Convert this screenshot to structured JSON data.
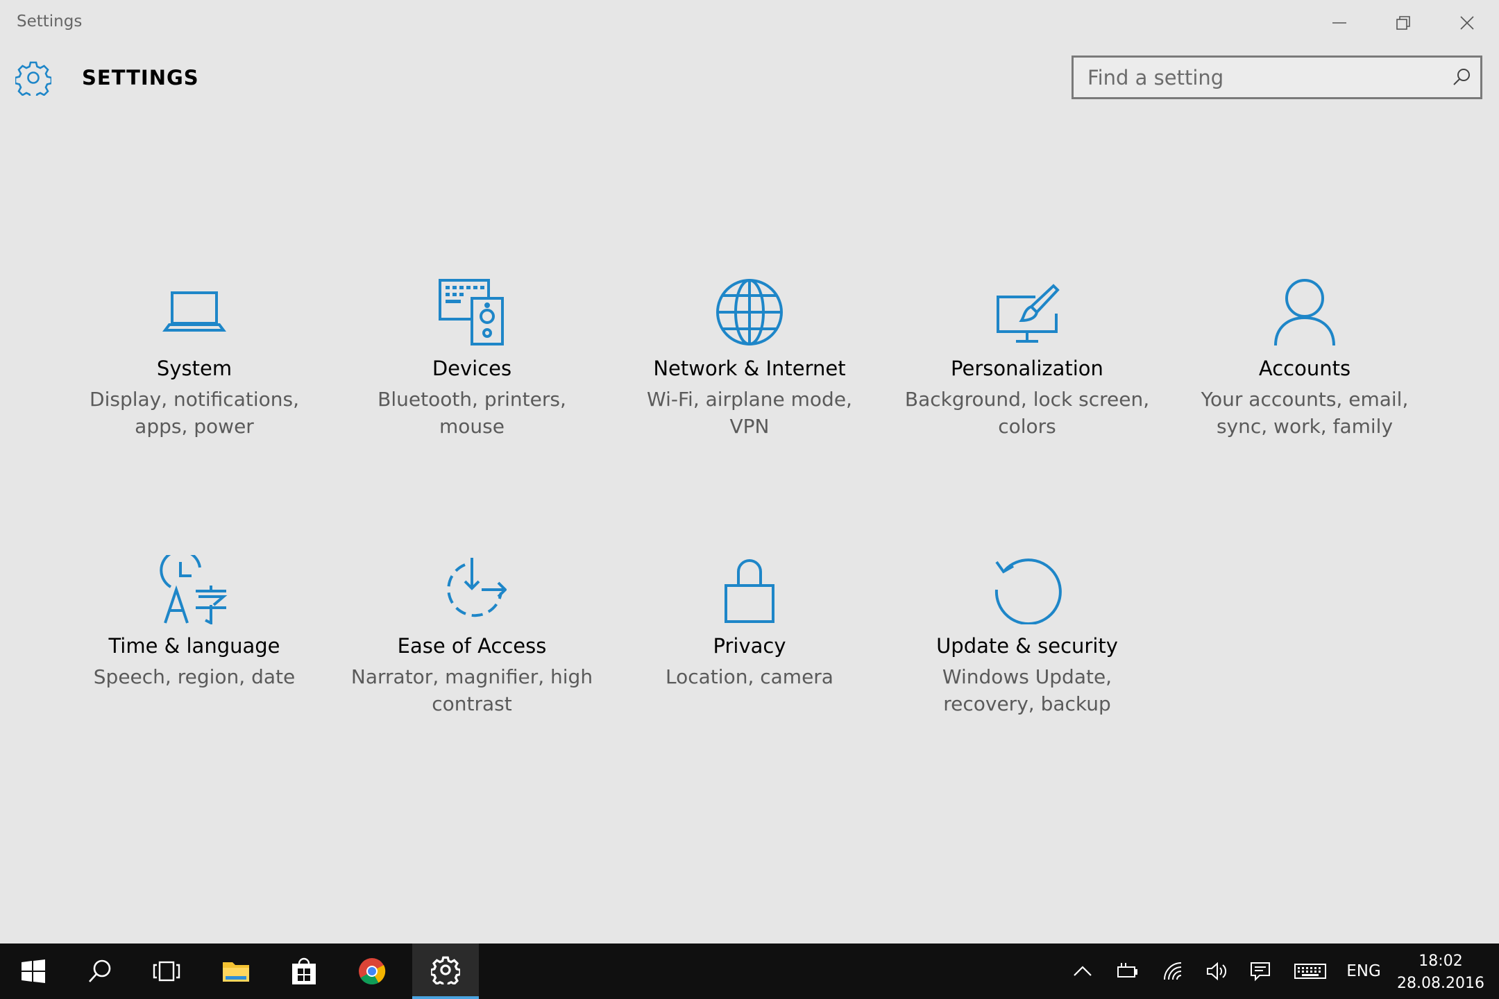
{
  "window": {
    "title": "Settings"
  },
  "header": {
    "title": "SETTINGS",
    "gear_icon": "gear-icon"
  },
  "search": {
    "placeholder": "Find a setting",
    "value": ""
  },
  "tiles": [
    {
      "title": "System",
      "desc": "Display, notifications, apps, power",
      "icon": "laptop-icon"
    },
    {
      "title": "Devices",
      "desc": "Bluetooth, printers, mouse",
      "icon": "devices-icon"
    },
    {
      "title": "Network & Internet",
      "desc": "Wi-Fi, airplane mode, VPN",
      "icon": "globe-icon"
    },
    {
      "title": "Personalization",
      "desc": "Background, lock screen, colors",
      "icon": "paint-monitor-icon"
    },
    {
      "title": "Accounts",
      "desc": "Your accounts, email, sync, work, family",
      "icon": "person-icon"
    },
    {
      "title": "Time & language",
      "desc": "Speech, region, date",
      "icon": "time-language-icon"
    },
    {
      "title": "Ease of Access",
      "desc": "Narrator, magnifier, high contrast",
      "icon": "ease-of-access-icon"
    },
    {
      "title": "Privacy",
      "desc": "Location, camera",
      "icon": "lock-icon"
    },
    {
      "title": "Update & security",
      "desc": "Windows Update, recovery, backup",
      "icon": "refresh-icon"
    }
  ],
  "taskbar": {
    "language": "ENG",
    "time": "18:02",
    "date": "28.08.2016"
  },
  "colors": {
    "accent": "#1e86c8",
    "background": "#e6e6e6",
    "taskbar": "#101010"
  }
}
